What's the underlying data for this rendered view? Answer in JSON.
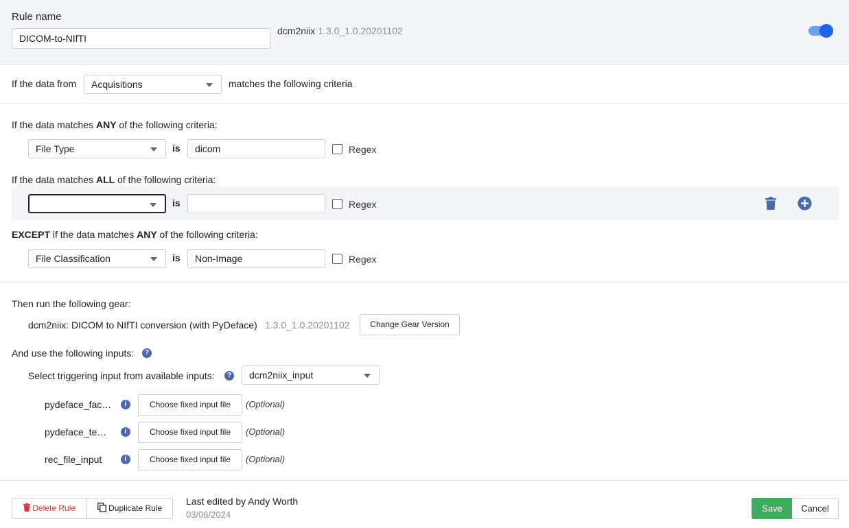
{
  "header": {
    "rule_name_label": "Rule name",
    "rule_name_value": "DICOM-to-NIfTI",
    "gear_name": "dcm2niix",
    "gear_version": "1.3.0_1.0.20201102",
    "enabled": true
  },
  "data_source": {
    "prefix": "If the data from",
    "selected": "Acquisitions",
    "suffix": "matches the following criteria"
  },
  "criteria_any": {
    "heading_pre": "If the data matches",
    "heading_bold": "ANY",
    "heading_post": "of the following criteria:",
    "field": "File Type",
    "operator": "is",
    "value": "dicom",
    "regex_label": "Regex"
  },
  "criteria_all": {
    "heading_pre": "If the data matches",
    "heading_bold": "ALL",
    "heading_post": "of the following criteria:",
    "field": "",
    "operator": "is",
    "value": "",
    "regex_label": "Regex"
  },
  "criteria_except": {
    "heading_bold1": "EXCEPT",
    "heading_mid": "if the data matches",
    "heading_bold2": "ANY",
    "heading_post": "of the following criteria:",
    "field": "File Classification",
    "operator": "is",
    "value": "Non-Image",
    "regex_label": "Regex"
  },
  "gear": {
    "heading": "Then run the following gear:",
    "name": "dcm2niix: DICOM to NIfTI conversion (with PyDeface)",
    "version": "1.3.0_1.0.20201102",
    "change_button": "Change Gear Version"
  },
  "inputs": {
    "heading": "And use the following inputs:",
    "trigger_label": "Select triggering input from available inputs:",
    "trigger_selected": "dcm2niix_input",
    "fixed": [
      {
        "name": "pydeface_fac…",
        "button": "Choose fixed input file",
        "note": "(Optional)"
      },
      {
        "name": "pydeface_te…",
        "button": "Choose fixed input file",
        "note": "(Optional)"
      },
      {
        "name": "rec_file_input",
        "button": "Choose fixed input file",
        "note": "(Optional)"
      }
    ]
  },
  "footer": {
    "delete_label": "Delete Rule",
    "duplicate_label": "Duplicate Rule",
    "edited_by": "Last edited by Andy Worth",
    "edited_date": "03/06/2024",
    "save_label": "Save",
    "cancel_label": "Cancel"
  },
  "colors": {
    "accent": "#1f63e8",
    "save": "#3daa5c",
    "delete": "#d9343a",
    "info_icon": "#4a6aa8"
  }
}
